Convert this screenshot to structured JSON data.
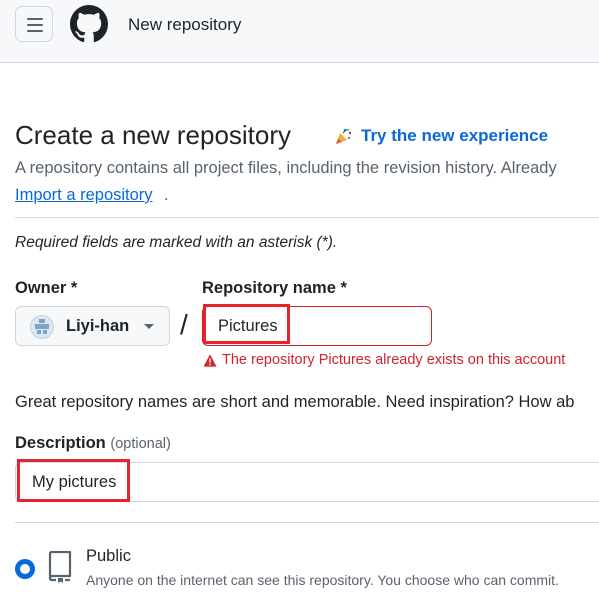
{
  "header": {
    "title": "New repository",
    "menu_icon": "hamburger-icon",
    "logo_icon": "github-mark-icon"
  },
  "page": {
    "heading": "Create a new repository",
    "try_link": "Try the new experience",
    "intro": "A repository contains all project files, including the revision history. Already",
    "import_link": "Import a repository",
    "import_suffix": ".",
    "required_note": "Required fields are marked with an asterisk (*)."
  },
  "form": {
    "owner_label": "Owner *",
    "owner_value": "Liyi-han",
    "separator": "/",
    "repo_label": "Repository name *",
    "repo_value": "Pictures",
    "repo_error": "The repository Pictures already exists on this account",
    "name_hint": "Great repository names are short and memorable. Need inspiration? How ab",
    "description_label": "Description",
    "description_optional": "(optional)",
    "description_value": "My pictures"
  },
  "visibility": {
    "selected": "public",
    "public_label": "Public",
    "public_desc": "Anyone on the internet can see this repository. You choose who can commit."
  },
  "colors": {
    "accent": "#0969da",
    "danger": "#d1242f",
    "highlight_box": "#e5242e",
    "muted_text": "#59636e",
    "border": "#d0d7de"
  }
}
